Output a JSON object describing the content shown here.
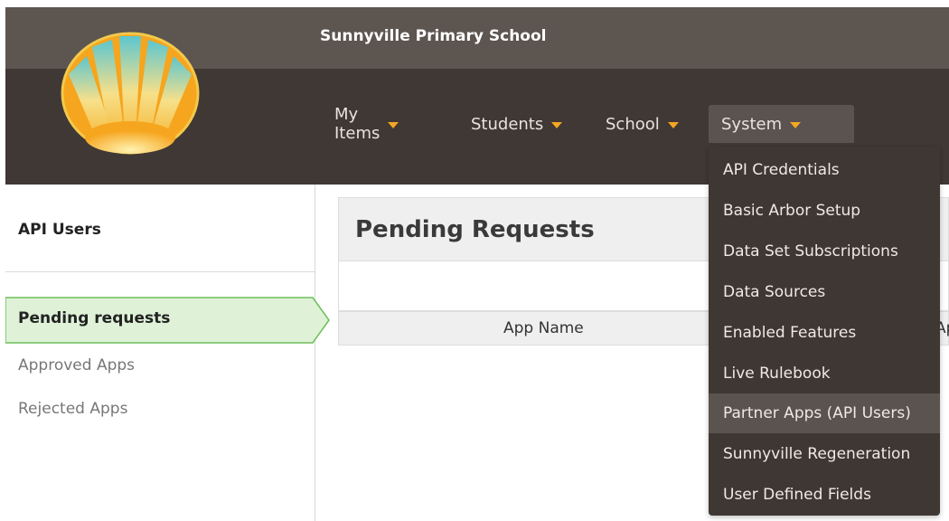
{
  "header": {
    "school_name": "Sunnyville Primary School",
    "logo": "sunburst-logo"
  },
  "nav": {
    "items": [
      {
        "label": "My Items"
      },
      {
        "label": "Students"
      },
      {
        "label": "School"
      },
      {
        "label": "System"
      }
    ],
    "active": "System",
    "caret_icon": "caret-down-icon",
    "caret_color": "#f5a623"
  },
  "dropdown": {
    "items": [
      {
        "label": "API Credentials"
      },
      {
        "label": "Basic Arbor Setup"
      },
      {
        "label": "Data Set Subscriptions"
      },
      {
        "label": "Data Sources"
      },
      {
        "label": "Enabled Features"
      },
      {
        "label": "Live Rulebook"
      },
      {
        "label": "Partner Apps (API Users)"
      },
      {
        "label": "Sunnyville Regeneration"
      },
      {
        "label": "User Defined Fields"
      }
    ],
    "highlighted": "Partner Apps (API Users)"
  },
  "sidebar": {
    "title": "API Users",
    "items": [
      {
        "label": "Pending requests"
      },
      {
        "label": "Approved Apps"
      },
      {
        "label": "Rejected Apps"
      }
    ],
    "active": "Pending requests",
    "active_color": "#dff2d8"
  },
  "main": {
    "title": "Pending Requests",
    "columns": [
      {
        "label": "App Name"
      },
      {
        "label": "Ap"
      }
    ]
  },
  "colors": {
    "header_top": "#5d5550",
    "header_nav": "#3f3834",
    "dropdown_bg": "#3e3733",
    "accent": "#f5a623",
    "active_green": "#dff2d8",
    "active_green_border": "#6dbf57"
  }
}
